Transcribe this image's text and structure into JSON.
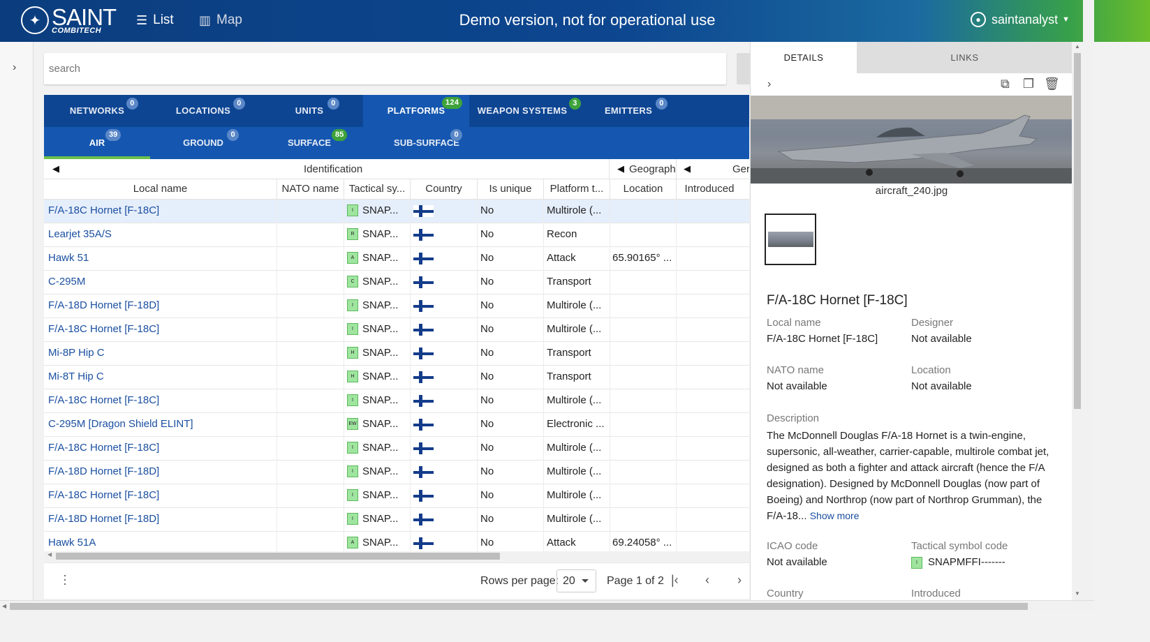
{
  "header": {
    "logo_main": "SAINT",
    "logo_sub": "COMBITECH",
    "nav_list": "List",
    "nav_map": "Map",
    "title": "Demo version, not for operational use",
    "user": "saintanalyst"
  },
  "search": {
    "placeholder": "search"
  },
  "categories": [
    {
      "label": "NETWORKS",
      "count": "0"
    },
    {
      "label": "LOCATIONS",
      "count": "0"
    },
    {
      "label": "UNITS",
      "count": "0"
    },
    {
      "label": "PLATFORMS",
      "count": "124"
    },
    {
      "label": "WEAPON SYSTEMS",
      "count": "3"
    },
    {
      "label": "EMITTERS",
      "count": "0"
    }
  ],
  "subcategories": [
    {
      "label": "AIR",
      "count": "39"
    },
    {
      "label": "GROUND",
      "count": "0"
    },
    {
      "label": "SURFACE",
      "count": "85"
    },
    {
      "label": "SUB-SURFACE",
      "count": "0"
    }
  ],
  "table": {
    "groups": {
      "identification": "Identification",
      "geography": "Geograph",
      "general": "Ger"
    },
    "columns": [
      "Local name",
      "NATO name",
      "Tactical sy...",
      "Country",
      "Is unique",
      "Platform t...",
      "Location",
      "Introduced"
    ],
    "rows": [
      {
        "name": "F/A-18C Hornet [F-18C]",
        "sym": "I",
        "tactical": "SNAP...",
        "unique": "No",
        "type": "Multirole (...",
        "location": ""
      },
      {
        "name": "Learjet 35A/S",
        "sym": "R",
        "tactical": "SNAP...",
        "unique": "No",
        "type": "Recon",
        "location": ""
      },
      {
        "name": "Hawk 51",
        "sym": "A",
        "tactical": "SNAP...",
        "unique": "No",
        "type": "Attack",
        "location": "65.90165° ..."
      },
      {
        "name": "C-295M",
        "sym": "C",
        "tactical": "SNAP...",
        "unique": "No",
        "type": "Transport",
        "location": ""
      },
      {
        "name": "F/A-18D Hornet [F-18D]",
        "sym": "I",
        "tactical": "SNAP...",
        "unique": "No",
        "type": "Multirole (...",
        "location": ""
      },
      {
        "name": "F/A-18C Hornet [F-18C]",
        "sym": "I",
        "tactical": "SNAP...",
        "unique": "No",
        "type": "Multirole (...",
        "location": ""
      },
      {
        "name": "Mi-8P Hip C",
        "sym": "H",
        "tactical": "SNAP...",
        "unique": "No",
        "type": "Transport",
        "location": ""
      },
      {
        "name": "Mi-8T Hip C",
        "sym": "H",
        "tactical": "SNAP...",
        "unique": "No",
        "type": "Transport",
        "location": ""
      },
      {
        "name": "F/A-18C Hornet [F-18C]",
        "sym": "I",
        "tactical": "SNAP...",
        "unique": "No",
        "type": "Multirole (...",
        "location": ""
      },
      {
        "name": "C-295M [Dragon Shield ELINT]",
        "sym": "EW",
        "tactical": "SNAP...",
        "unique": "No",
        "type": "Electronic ...",
        "location": ""
      },
      {
        "name": "F/A-18C Hornet [F-18C]",
        "sym": "I",
        "tactical": "SNAP...",
        "unique": "No",
        "type": "Multirole (...",
        "location": ""
      },
      {
        "name": "F/A-18D Hornet [F-18D]",
        "sym": "I",
        "tactical": "SNAP...",
        "unique": "No",
        "type": "Multirole (...",
        "location": ""
      },
      {
        "name": "F/A-18C Hornet [F-18C]",
        "sym": "I",
        "tactical": "SNAP...",
        "unique": "No",
        "type": "Multirole (...",
        "location": ""
      },
      {
        "name": "F/A-18D Hornet [F-18D]",
        "sym": "I",
        "tactical": "SNAP...",
        "unique": "No",
        "type": "Multirole (...",
        "location": ""
      },
      {
        "name": "Hawk 51A",
        "sym": "A",
        "tactical": "SNAP...",
        "unique": "No",
        "type": "Attack",
        "location": "69.24058° ..."
      }
    ]
  },
  "pager": {
    "rows_per_page_label": "Rows per page:",
    "rows_per_page_value": "20",
    "page_info": "Page 1 of 2"
  },
  "details": {
    "tab_details": "DETAILS",
    "tab_links": "LINKS",
    "image_name": "aircraft_240.jpg",
    "title": "F/A-18C Hornet [F-18C]",
    "local_name_label": "Local name",
    "local_name_value": "F/A-18C Hornet [F-18C]",
    "designer_label": "Designer",
    "designer_value": "Not available",
    "nato_name_label": "NATO name",
    "nato_name_value": "Not available",
    "location_label": "Location",
    "location_value": "Not available",
    "description_label": "Description",
    "description_text": "The McDonnell Douglas F/A-18 Hornet is a twin-engine, supersonic, all-weather, carrier-capable, multirole combat jet, designed as both a fighter and attack aircraft (hence the F/A designation). Designed by McDonnell Douglas (now part of Boeing) and Northrop (now part of Northrop Grumman), the F/A-18...",
    "show_more": "Show more",
    "icao_label": "ICAO code",
    "icao_value": "Not available",
    "tactical_label": "Tactical symbol code",
    "tactical_value": "SNAPMFFI-------",
    "country_label": "Country",
    "introduced_label": "Introduced"
  },
  "colors": {
    "header_blue": "#0b3d7e",
    "header_green": "#6cbd2b",
    "tab_blue": "#0d4593",
    "subtab_blue": "#1557b0",
    "active_underline": "#6cc04a",
    "link_blue": "#1a4fa0",
    "badge_green": "#3ea33a"
  }
}
